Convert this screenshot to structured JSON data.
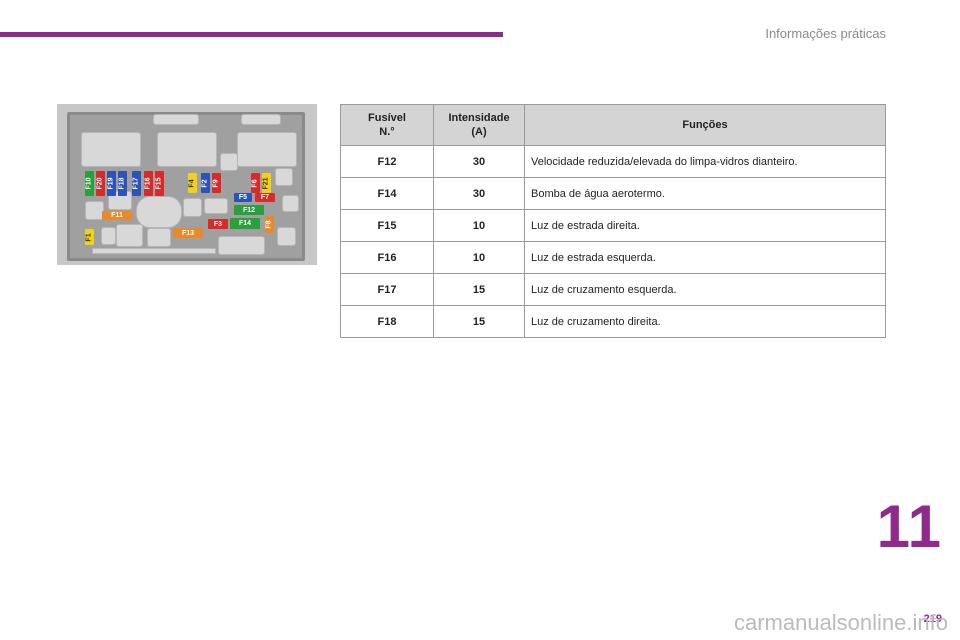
{
  "header": {
    "section_title": "Informações práticas",
    "accent_color": "#8e2a8c"
  },
  "diagram": {
    "row1": [
      "F10",
      "F20",
      "F19",
      "F18",
      "F17",
      "F16",
      "F15",
      "F4",
      "F2",
      "F9",
      "F6",
      "F21"
    ],
    "row2": [
      "F5",
      "F7"
    ],
    "row3": [
      "F11",
      "F12"
    ],
    "row4": [
      "F3",
      "F14",
      "F8"
    ],
    "row5": [
      "F1",
      "F13"
    ]
  },
  "table": {
    "headers": {
      "fuse": "Fusível\nN.°",
      "current": "Intensidade\n(A)",
      "functions": "Funções"
    },
    "rows": [
      {
        "fuse": "F12",
        "current": "30",
        "function": "Velocidade reduzida/elevada do limpa-vidros dianteiro."
      },
      {
        "fuse": "F14",
        "current": "30",
        "function": "Bomba de água aerotermo."
      },
      {
        "fuse": "F15",
        "current": "10",
        "function": "Luz de estrada direita."
      },
      {
        "fuse": "F16",
        "current": "10",
        "function": "Luz de estrada esquerda."
      },
      {
        "fuse": "F17",
        "current": "15",
        "function": "Luz de cruzamento esquerda."
      },
      {
        "fuse": "F18",
        "current": "15",
        "function": "Luz de cruzamento direita."
      }
    ]
  },
  "footer": {
    "chapter": "11",
    "page": "219",
    "watermark": "carmanualsonline.info"
  }
}
